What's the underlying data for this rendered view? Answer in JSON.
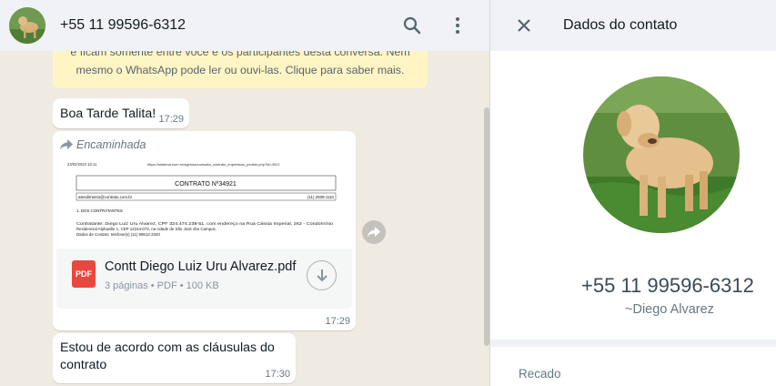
{
  "chat": {
    "contact_title": "+55 11 99596-6312",
    "encryption_notice_line1": "e ficam somente entre você e os participantes desta conversa. Nem",
    "encryption_notice_line2": "mesmo o WhatsApp pode ler ou ouvi-las. Clique para saber mais.",
    "messages": [
      {
        "text": "Boa Tarde Talita!",
        "time": "17:29"
      },
      {
        "forwarded_label": "Encaminhada",
        "document": {
          "preview": {
            "date": "23/02/2023 16:11",
            "url": "https://sistema.com.br/agenda/consulta_contrato_impressao_pedido.php?id=4921",
            "title": "CONTRATO Nº34921",
            "email": "atendimento@contrato.com.br",
            "phone": "(11) 2939-1110",
            "section": "1. DOS CONTRATANTES",
            "line1": "Contratante: Diego Luiz Uru Alvarez, CPF 324.474.238-51, com endereço na Rua Cássia Imperial, 262 - Condomínio",
            "line2": "Residencial Alphaville 1, CEP 12244-073, na cidade de São José dos Campos.",
            "line3": "Dados de Contato: telefone(s) (11) 99512-3340"
          },
          "icon_label": "PDF",
          "name": "Contt Diego Luiz Uru Alvarez.pdf",
          "meta": "3 páginas • PDF • 100 KB"
        },
        "time": "17:29"
      },
      {
        "text": "Estou de acordo com as cláusulas do contrato",
        "time": "17:30"
      }
    ]
  },
  "contact_panel": {
    "title": "Dados do contato",
    "phone": "+55 11 99596-6312",
    "name": "~Diego Alvarez",
    "recado_label": "Recado"
  },
  "icons": {
    "search": "search-icon",
    "menu": "menu-icon",
    "close": "close-icon",
    "forward": "forward-icon",
    "download": "download-icon"
  },
  "colors": {
    "chat_bg": "#efeae2",
    "header_bg": "#f0f2f5",
    "bubble_bg": "#ffffff",
    "notice_bg": "#fff5c4",
    "pdf_red": "#e9483f"
  }
}
